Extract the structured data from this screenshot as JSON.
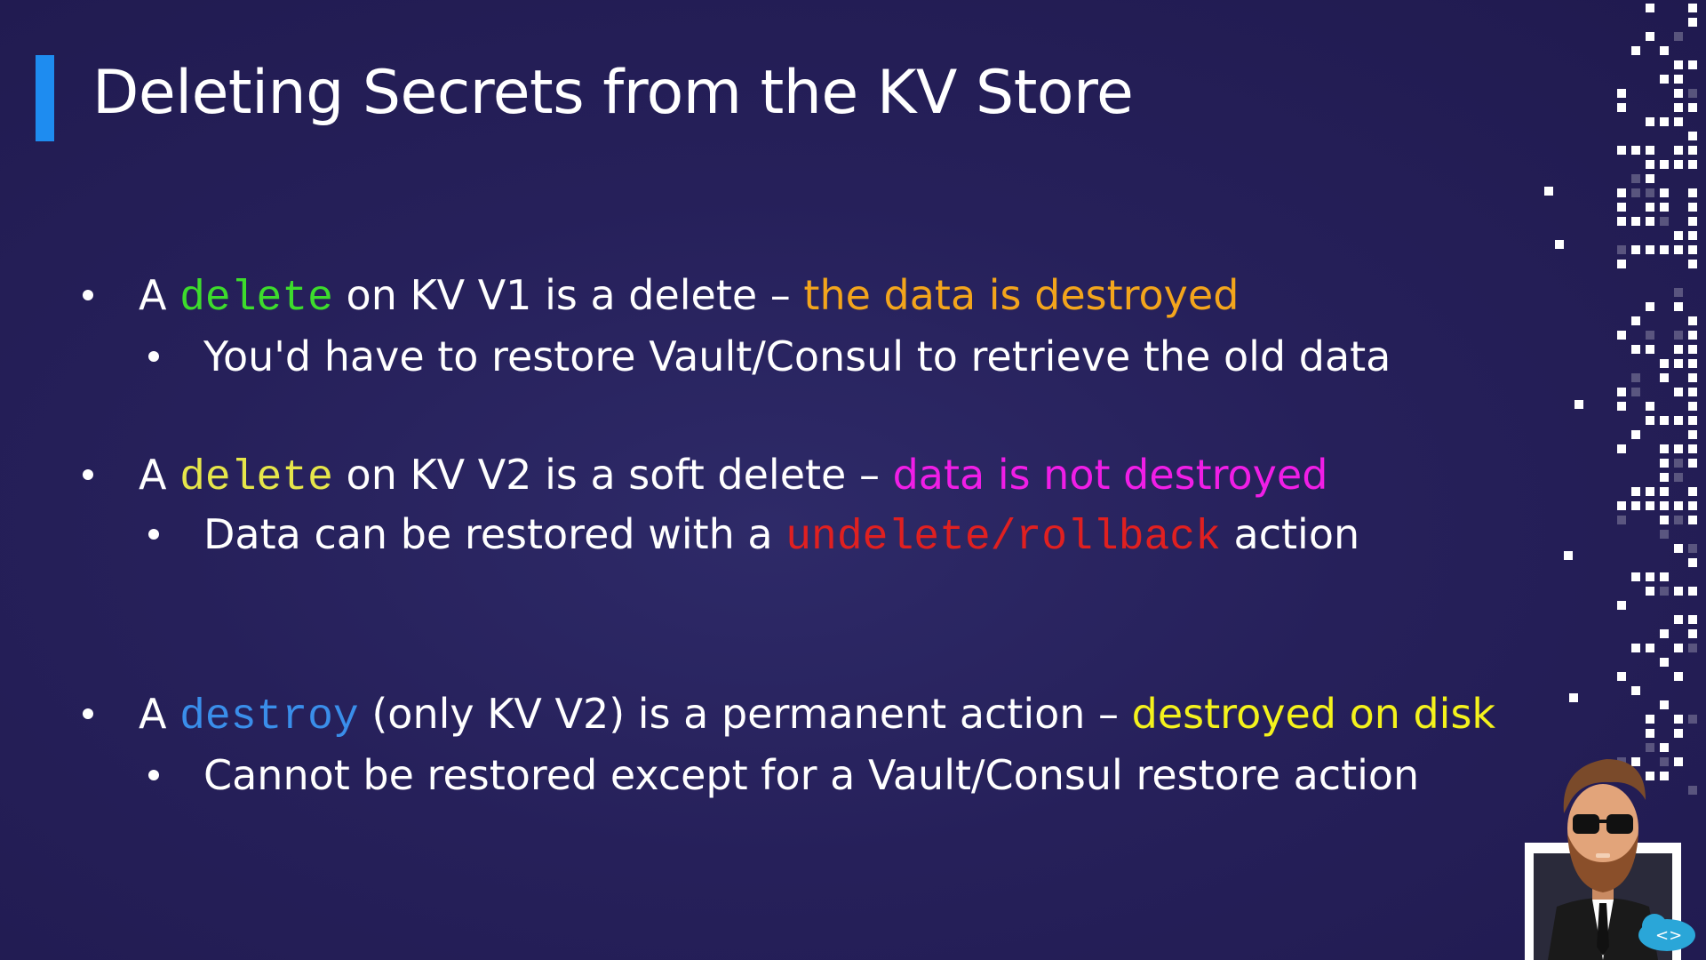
{
  "slide": {
    "title": "Deleting Secrets from the KV Store"
  },
  "bullets": [
    {
      "prefix": "A ",
      "code": "delete",
      "code_color": "#3ddc2c",
      "middle": " on KV V1 is a delete – ",
      "highlight": "the data is destroyed",
      "highlight_color": "#f3a51c",
      "sub": {
        "text": "You'd have to restore Vault/Consul to retrieve the old data"
      }
    },
    {
      "prefix": "A ",
      "code": "delete",
      "code_color": "#e6e64a",
      "middle": " on KV V2 is a soft delete – ",
      "highlight": "data is not destroyed",
      "highlight_color": "#f01ee6",
      "sub": {
        "before": "Data can be restored with a ",
        "code": "undelete/rollback",
        "code_color": "#e02020",
        "after": " action"
      }
    },
    {
      "prefix": "A ",
      "code": "destroy",
      "code_color": "#3a8eea",
      "middle": " (only KV V2) is a permanent action – ",
      "highlight": "destroyed on disk",
      "highlight_color": "#f4f21c",
      "sub": {
        "text": "Cannot be restored except for a Vault/Consul restore action"
      }
    }
  ],
  "decoration": {
    "pixel_pattern": "white-square-matrix",
    "avatar": "presenter-avatar-icon",
    "badge": "code-cloud-icon"
  },
  "colors": {
    "background": "#26205a",
    "accent_bar": "#1e8cf0",
    "text": "#ffffff"
  }
}
